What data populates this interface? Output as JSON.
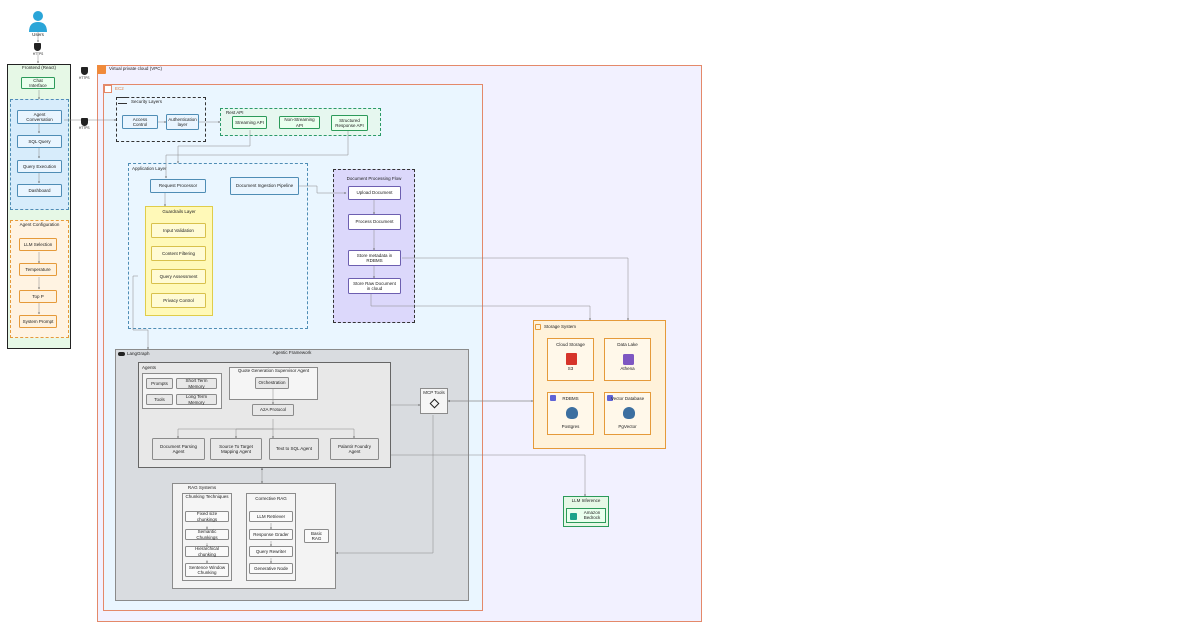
{
  "users": {
    "label": "Users",
    "https": "HTTPS"
  },
  "https_labels": {
    "frontend_out": "HTTPS",
    "vpc_in": "HTTPS"
  },
  "frontend": {
    "title": "Frontend (React)",
    "chat": "Chat Interface",
    "items": [
      "Agent Conversation",
      "SQL Query",
      "Query Execution",
      "Dashboard"
    ],
    "config_title": "Agent Configuration",
    "config_items": [
      "LLM Selection",
      "Temperature",
      "Top P",
      "System Prompt"
    ]
  },
  "vpc": {
    "title": "Virtual private cloud (VPC)"
  },
  "ec2": {
    "title": "EC2"
  },
  "security": {
    "title": "Security Layers",
    "items": [
      "Access Control",
      "Authentication layer"
    ]
  },
  "rest_api": {
    "title": "Rest API",
    "items": [
      "Streaming API",
      "Non-Streaming API",
      "Structured Response API"
    ]
  },
  "application": {
    "title": "Application Layer",
    "request_processor": "Request Processor",
    "ingestion": "Document Ingestion Pipeline",
    "guardrails_title": "Guardrails Layer",
    "guardrails": [
      "Input Validation",
      "Content Filtering",
      "Query Assessment",
      "Privacy Control"
    ]
  },
  "doc_flow": {
    "title": "Document Processing Flow",
    "items": [
      "Upload Document",
      "Process Document",
      "Store metadata in RDBMS",
      "Store Raw Document in cloud"
    ]
  },
  "storage": {
    "title": "Storage System",
    "cards": [
      {
        "title": "Cloud Storage",
        "sub": "S3",
        "icon": "s3-bucket-icon",
        "color": "#d6342a"
      },
      {
        "title": "Data Lake",
        "sub": "Athena",
        "icon": "athena-icon",
        "color": "#7e57c2"
      },
      {
        "title": "RDBMS",
        "sub": "Postgres",
        "icon": "postgres-icon",
        "color": "#3c6fa0"
      },
      {
        "title": "Vector Database",
        "sub": "PgVector",
        "icon": "pgvector-icon",
        "color": "#3c6fa0"
      }
    ]
  },
  "llm": {
    "title": "LLM Inference",
    "item": "Amazon Bedrock"
  },
  "agentic": {
    "framework": "Agentic Framework",
    "langgraph": "LangGraph",
    "agents_title": "Agents",
    "memory": [
      "Prompts",
      "Short Term Memory",
      "Tools",
      "Long Term Memory"
    ],
    "supervisor_title": "Quote Generation Supervisor Agent",
    "orchestration": "Orchestration",
    "a2a": "A2A Protocol",
    "agents": [
      "Document Parsing Agent",
      "Source To Target Mapping Agent",
      "Text to SQL Agent",
      "Palantir Foundry Agent"
    ],
    "mcp": "MCP Tools"
  },
  "rag": {
    "title": "RAG Systems",
    "chunking_title": "Chunking Techniques",
    "chunking": [
      "Fixed size chunkings",
      "Semantic Chunkings",
      "Hierarchical chunking",
      "Sentence Window Chunking"
    ],
    "corrective_title": "Corrective RAG",
    "corrective": [
      "LLM Retriever",
      "Response Grader",
      "Query Rewriter",
      "Generative Node"
    ],
    "basic": "Basic RAG"
  },
  "colors": {
    "vpc": "#f2f1ff",
    "ec2": "#eaf6ff",
    "storage": "#fff2da",
    "frontend": "#e6f8e6",
    "agentic": "#d9dce0"
  }
}
